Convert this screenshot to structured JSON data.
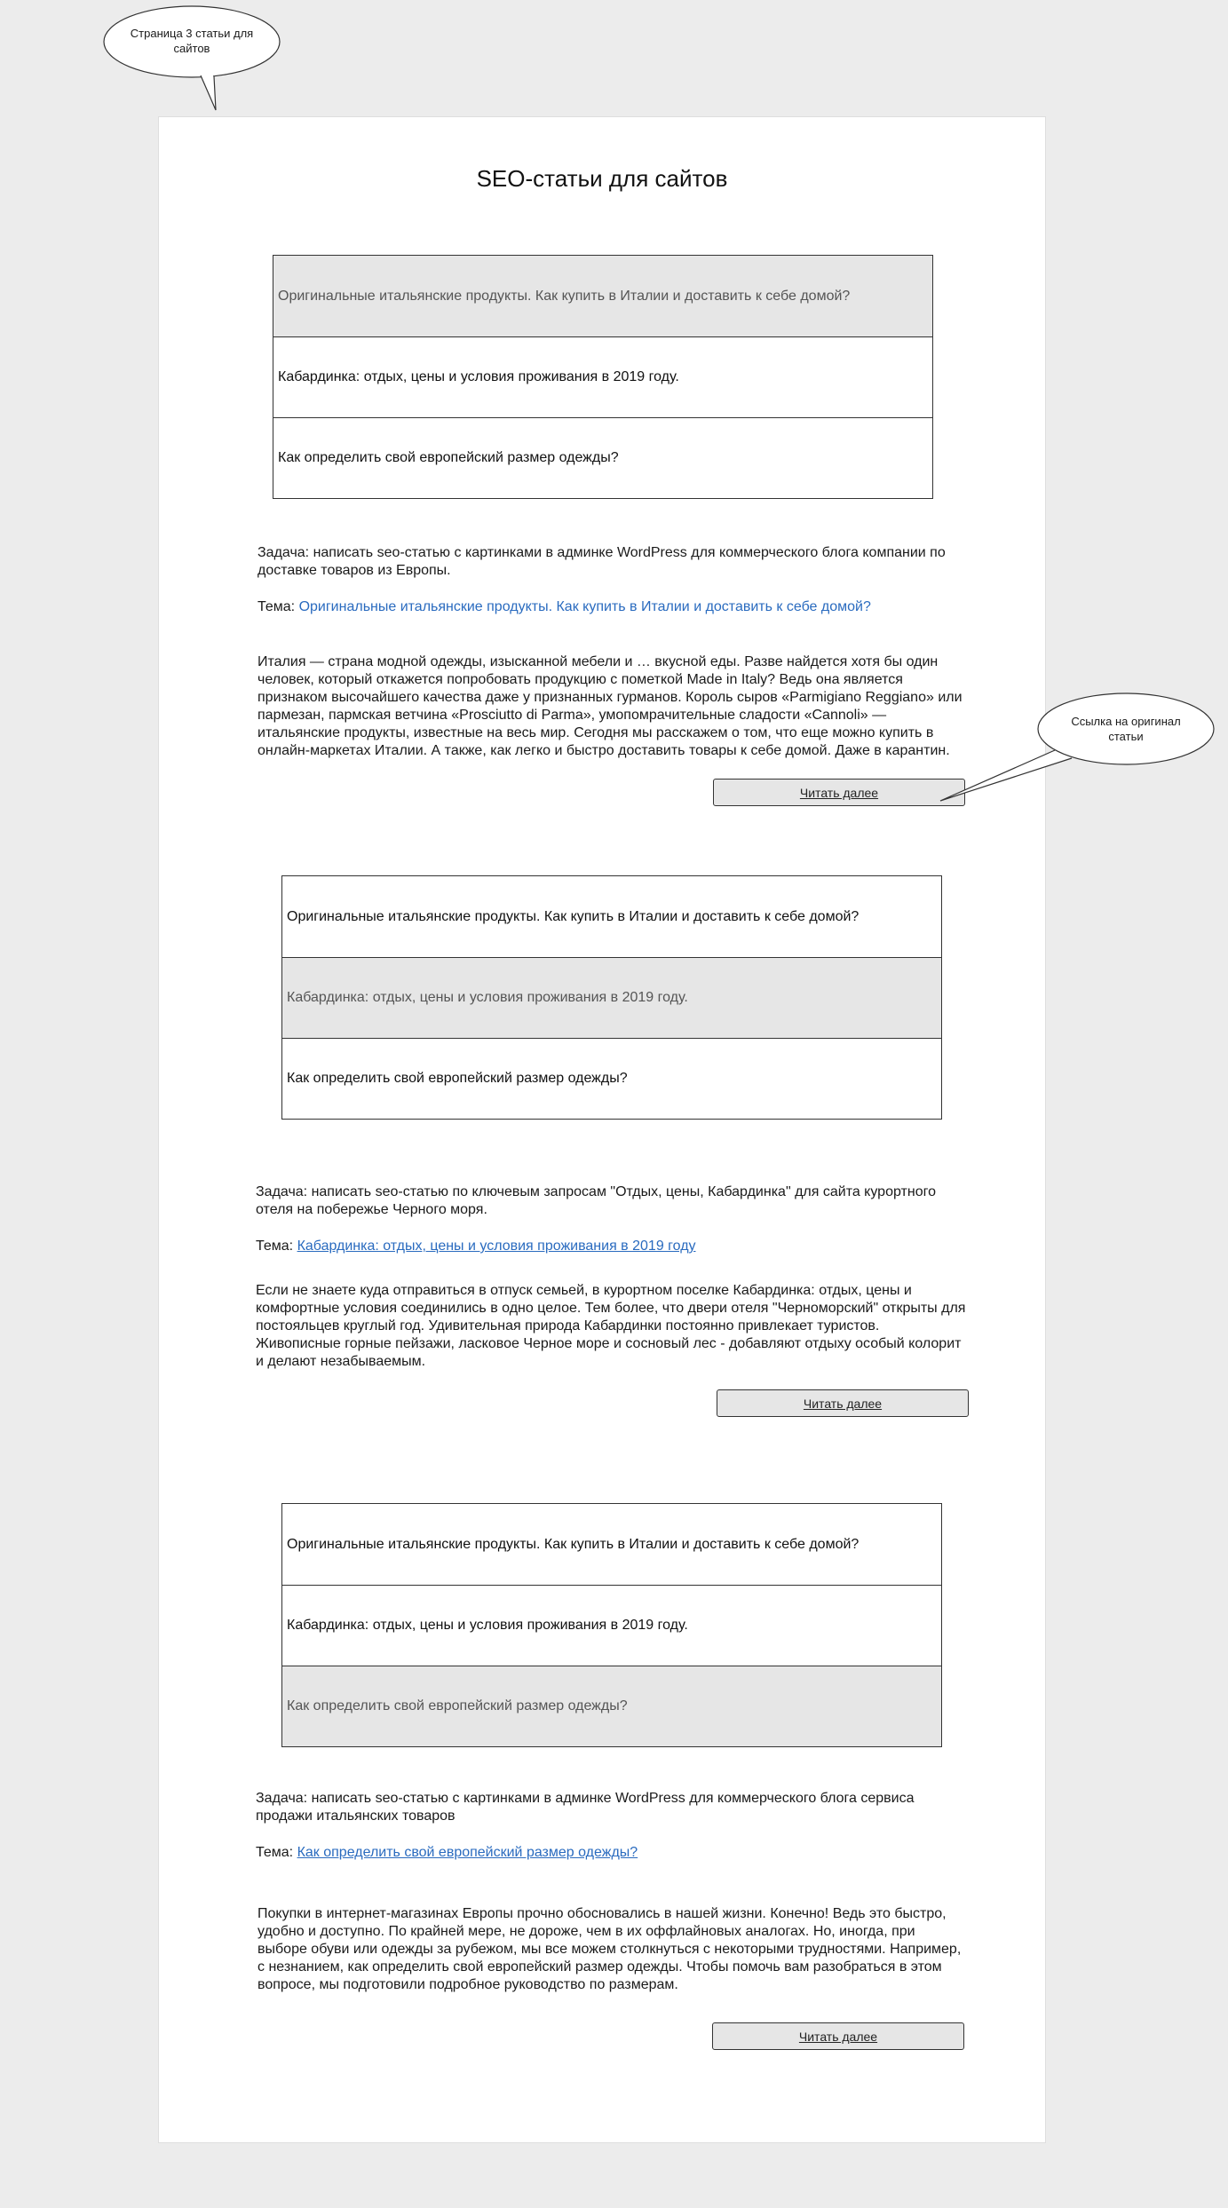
{
  "page": {
    "title": "SEO-статьи для сайтов"
  },
  "callouts": {
    "top": "Страница 3 статьи для сайтов",
    "link": "Ссылка на оригинал статьи"
  },
  "menu_items": [
    "Оригинальные итальянские продукты. Как купить в Италии и доставить к себе домой?",
    "Кабардинка: отдых, цены и условия проживания в 2019 году.",
    "Как определить свой европейский размер одежды?"
  ],
  "labels": {
    "theme_prefix": "Тема: ",
    "read_more": "Читать далее"
  },
  "articles": [
    {
      "active_index": 0,
      "task": "Задача: написать seo-статью с картинками в админке WordPress для коммерческого блога компании по доставке товаров из Европы.",
      "theme_link": "Оригинальные итальянские продукты. Как купить в Италии и доставить к себе домой?",
      "body": "Италия — страна модной одежды, изысканной мебели и … вкусной еды. Разве найдется хотя бы один человек, который откажется попробовать продукцию с пометкой Made in Italy? Ведь она является признаком высочайшего качества даже у признанных гурманов. Король сыров «Parmigiano Reggiano» или пармезан, пармская ветчина «Prosciutto di Parma», умопомрачительные сладости «Cannoli» — итальянские продукты, известные на весь мир. Сегодня мы расскажем о том, что еще можно купить в онлайн-маркетах Италии. А также, как легко и быстро доставить товары к себе домой. Даже в карантин."
    },
    {
      "active_index": 1,
      "task": "Задача: написать seo-статью по ключевым запросам \"Отдых, цены, Кабардинка\" для сайта курортного отеля  на побережье Черного моря.",
      "theme_link": "Кабардинка: отдых, цены и условия проживания в 2019 году",
      "body": "Если не знаете куда отправиться в отпуск семьей, в курортном поселке Кабардинка: отдых, цены и комфортные условия соединились в одно целое. Тем более, что двери отеля \"Черноморский\" открыты для постояльцев круглый год. Удивительная природа Кабардинки постоянно привлекает туристов. Живописные горные пейзажи, ласковое Черное море и сосновый лес - добавляют отдыху особый колорит и делают незабываемым."
    },
    {
      "active_index": 2,
      "task": "Задача: написать seo-статью с картинками в админке WordPress для коммерческого блога сервиса продажи итальянских товаров",
      "theme_link": "Как определить свой европейский размер одежды?",
      "body": "Покупки в интернет-магазинах Европы прочно обосновались в нашей жизни. Конечно! Ведь это быстро, удобно и доступно. По крайней мере, не дороже, чем в их оффлайновых аналогах. Но, иногда, при выборе обуви или одежды за рубежом, мы все можем столкнуться с некоторыми трудностями. Например, с незнанием, как определить свой европейский размер одежды. Чтобы помочь вам разобраться в этом вопросе, мы подготовили подробное руководство по размерам."
    }
  ],
  "colors": {
    "background": "#ececec",
    "page": "#ffffff",
    "active_item": "#e6e6e6",
    "link": "#2a6bbf",
    "border": "#333333"
  }
}
